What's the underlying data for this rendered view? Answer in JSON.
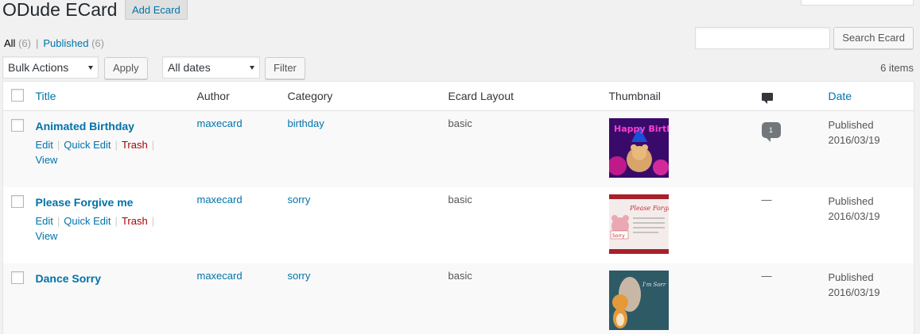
{
  "header": {
    "title": "ODude ECard",
    "add_new_label": "Add Ecard"
  },
  "views": {
    "all_label": "All",
    "all_count": "(6)",
    "separator": "|",
    "published_label": "Published",
    "published_count": "(6)"
  },
  "search": {
    "placeholder": "",
    "button_label": "Search Ecard"
  },
  "filters": {
    "bulk_actions": "Bulk Actions",
    "apply_label": "Apply",
    "dates": "All dates",
    "filter_label": "Filter"
  },
  "items_count": "6 items",
  "table": {
    "columns": {
      "title": "Title",
      "author": "Author",
      "category": "Category",
      "layout": "Ecard Layout",
      "thumbnail": "Thumbnail",
      "date": "Date"
    },
    "row_actions": {
      "edit": "Edit",
      "quick_edit": "Quick Edit",
      "trash": "Trash",
      "view": "View",
      "sep": "|"
    },
    "rows": [
      {
        "title": "Animated Birthday",
        "author": "maxecard",
        "category": "birthday",
        "layout": "basic",
        "comments": "1",
        "status": "Published",
        "date": "2016/03/19",
        "thumb_text": "Happy Birthday"
      },
      {
        "title": "Please Forgive me",
        "author": "maxecard",
        "category": "sorry",
        "layout": "basic",
        "comments": "—",
        "status": "Published",
        "date": "2016/03/19",
        "thumb_text": "Please Forgive M",
        "thumb_badge": "Sorry"
      },
      {
        "title": "Dance Sorry",
        "author": "maxecard",
        "category": "sorry",
        "layout": "basic",
        "comments": "—",
        "status": "Published",
        "date": "2016/03/19",
        "thumb_text": "I'm Sorr"
      }
    ]
  },
  "colors": {
    "link": "#0073aa",
    "trash": "#a00",
    "background": "#f1f1f1"
  }
}
